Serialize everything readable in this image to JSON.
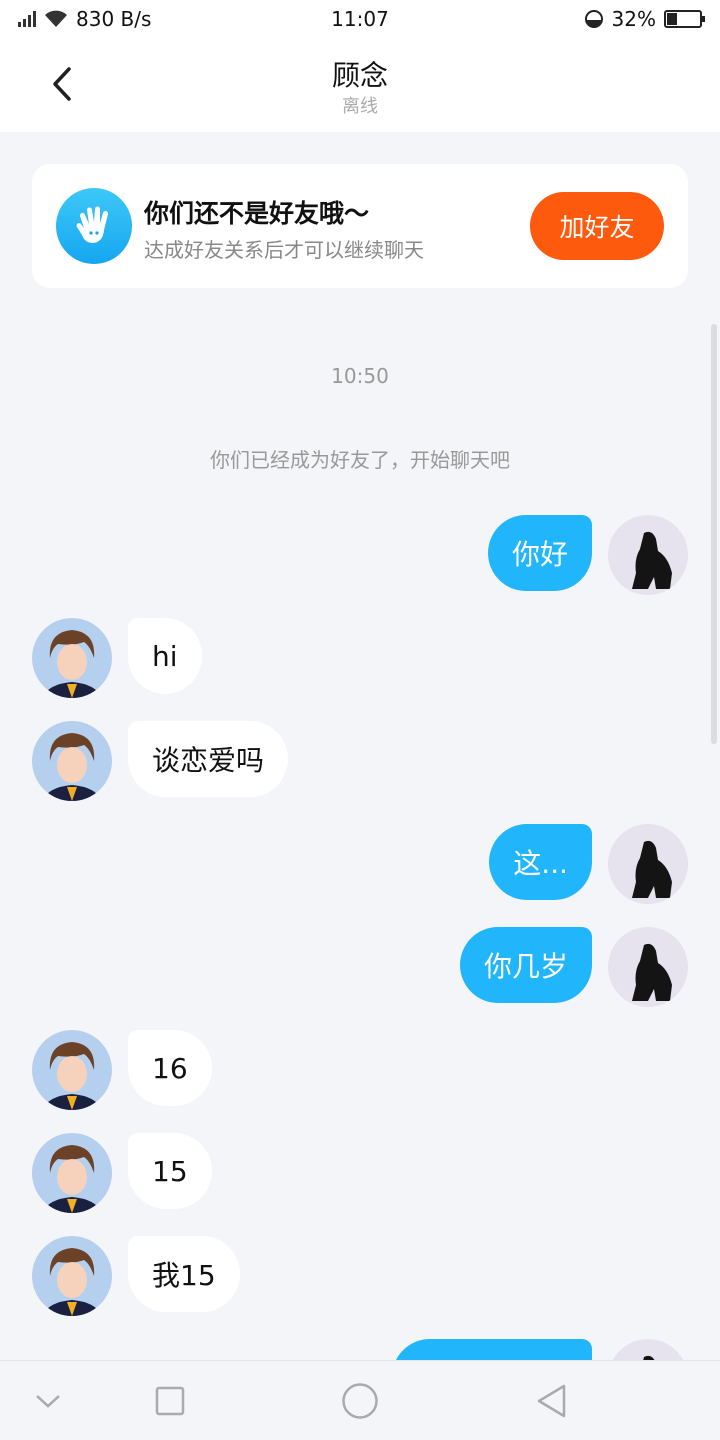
{
  "status_bar": {
    "net_speed": "830 B/s",
    "time": "11:07",
    "battery": "32%"
  },
  "header": {
    "title": "顾念",
    "subtitle": "离线"
  },
  "friend_card": {
    "title": "你们还不是好友哦～",
    "description": "达成好友关系后才可以继续聊天",
    "button_label": "加好友"
  },
  "chat": {
    "timestamp": "10:50",
    "system_message": "你们已经成为好友了，开始聊天吧",
    "messages": [
      {
        "side": "out",
        "text": "你好"
      },
      {
        "side": "in",
        "text": "hi"
      },
      {
        "side": "in",
        "text": "谈恋爱吗"
      },
      {
        "side": "out",
        "text": "这..."
      },
      {
        "side": "out",
        "text": "你几岁"
      },
      {
        "side": "in",
        "text": "16"
      },
      {
        "side": "in",
        "text": "15"
      },
      {
        "side": "in",
        "text": "我15"
      },
      {
        "side": "out",
        "text": ""
      }
    ]
  },
  "colors": {
    "accent_blue": "#21b6fb",
    "add_friend_orange": "#fd5a0e",
    "background": "#f4f5f8"
  },
  "icons": {
    "back": "chevron-left-icon",
    "nav_down": "chevron-down-icon",
    "nav_recent": "square-icon",
    "nav_home": "circle-icon",
    "nav_back": "triangle-back-icon",
    "card": "hand-wave-icon"
  }
}
